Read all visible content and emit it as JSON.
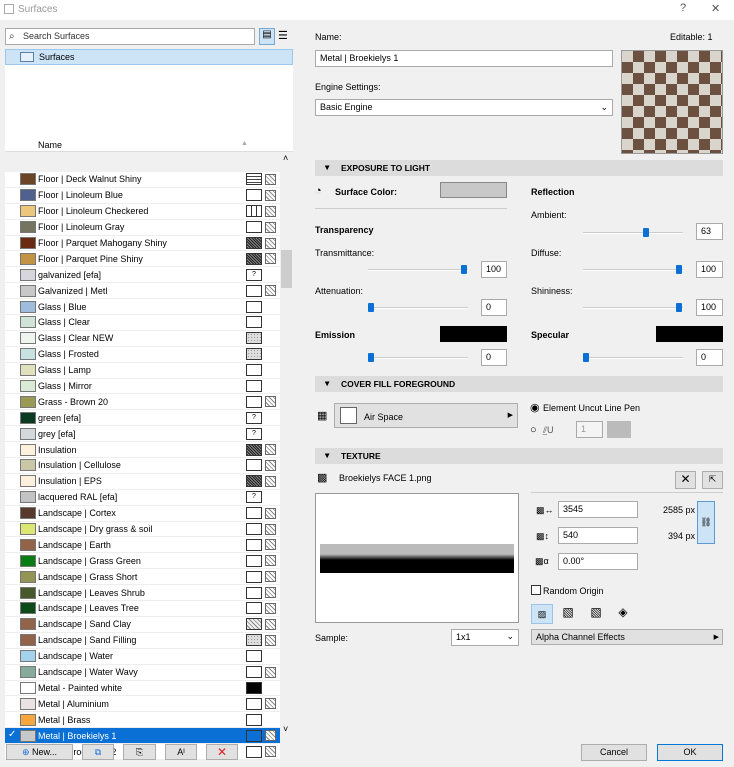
{
  "window": {
    "title": "Surfaces",
    "help": "?",
    "close": "✕"
  },
  "search": {
    "placeholder": "Search Surfaces"
  },
  "tree": {
    "root": "Surfaces"
  },
  "list": {
    "header": "Name",
    "selected_index": 35,
    "items": [
      {
        "name": "Floor | Deck Walnut Shiny",
        "color": "#6b4526",
        "fill": "lines",
        "tex": true
      },
      {
        "name": "Floor | Linoleum Blue",
        "color": "#50608f",
        "fill": "empty",
        "tex": true
      },
      {
        "name": "Floor | Linoleum Checkered",
        "color": "#ecc67c",
        "fill": "grid",
        "tex": true
      },
      {
        "name": "Floor | Linoleum Gray",
        "color": "#747461",
        "fill": "empty",
        "tex": true
      },
      {
        "name": "Floor | Parquet Mahogany Shiny",
        "color": "#6a2a12",
        "fill": "dark",
        "tex": true
      },
      {
        "name": "Floor | Parquet Pine Shiny",
        "color": "#c19342",
        "fill": "dark",
        "tex": true
      },
      {
        "name": "galvanized [efa]",
        "color": "#d6d6dc",
        "fill": "?",
        "tex": false
      },
      {
        "name": "Galvanized | Metl",
        "color": "#c8c8c8",
        "fill": "empty",
        "tex": true
      },
      {
        "name": "Glass | Blue",
        "color": "#a0bcdd",
        "fill": "empty",
        "tex": false
      },
      {
        "name": "Glass | Clear",
        "color": "#cfe4d6",
        "fill": "empty",
        "tex": false
      },
      {
        "name": "Glass | Clear NEW",
        "color": "#eef5ef",
        "fill": "dots",
        "tex": false
      },
      {
        "name": "Glass | Frosted",
        "color": "#c7e2e1",
        "fill": "dots",
        "tex": false
      },
      {
        "name": "Glass | Lamp",
        "color": "#e0e2bd",
        "fill": "empty",
        "tex": false
      },
      {
        "name": "Glass | Mirror",
        "color": "#d9ead5",
        "fill": "empty",
        "tex": false
      },
      {
        "name": "Grass - Brown 20",
        "color": "#9a9a55",
        "fill": "empty",
        "tex": true
      },
      {
        "name": "green [efa]",
        "color": "#0a3a1f",
        "fill": "?",
        "tex": false
      },
      {
        "name": "grey [efa]",
        "color": "#d3d8dc",
        "fill": "?",
        "tex": false
      },
      {
        "name": "Insulation",
        "color": "#fdf0dd",
        "fill": "dark",
        "tex": true
      },
      {
        "name": "Insulation | Cellulose",
        "color": "#c9c7a5",
        "fill": "empty",
        "tex": true
      },
      {
        "name": "Insulation | EPS",
        "color": "#fdf0dd",
        "fill": "dark",
        "tex": true
      },
      {
        "name": "lacquered RAL [efa]",
        "color": "#c2c3c4",
        "fill": "?",
        "tex": false
      },
      {
        "name": "Landscape | Cortex",
        "color": "#573a2b",
        "fill": "empty",
        "tex": true
      },
      {
        "name": "Landscape | Dry grass & soil",
        "color": "#dbe772",
        "fill": "empty",
        "tex": true
      },
      {
        "name": "Landscape | Earth",
        "color": "#916349",
        "fill": "empty",
        "tex": true
      },
      {
        "name": "Landscape | Grass Green",
        "color": "#0a7c14",
        "fill": "empty",
        "tex": true
      },
      {
        "name": "Landscape | Grass Short",
        "color": "#949455",
        "fill": "empty",
        "tex": true
      },
      {
        "name": "Landscape | Leaves Shrub",
        "color": "#47592c",
        "fill": "empty",
        "tex": true
      },
      {
        "name": "Landscape | Leaves Tree",
        "color": "#0c4a19",
        "fill": "empty",
        "tex": true
      },
      {
        "name": "Landscape | Sand Clay",
        "color": "#916349",
        "fill": "hatch",
        "tex": true
      },
      {
        "name": "Landscape | Sand Filling",
        "color": "#916349",
        "fill": "dots",
        "tex": true
      },
      {
        "name": "Landscape | Water",
        "color": "#a4d2ec",
        "fill": "empty",
        "tex": false
      },
      {
        "name": "Landscape | Water Wavy",
        "color": "#87ab9b",
        "fill": "empty",
        "tex": true
      },
      {
        "name": "Metal - Painted white",
        "color": "#ffffff",
        "fill": "black",
        "tex": false
      },
      {
        "name": "Metal | Aluminium",
        "color": "#ebe2e2",
        "fill": "empty",
        "tex": true
      },
      {
        "name": "Metal | Brass",
        "color": "#f8a73d",
        "fill": "empty",
        "tex": false
      },
      {
        "name": "Metal | Broekielys 1",
        "color": "#c8c8c8",
        "fill": "sel",
        "tex": true
      },
      {
        "name": "Metal | Broekielys 2",
        "color": "#c8c8c8",
        "fill": "empty",
        "tex": true
      }
    ]
  },
  "bottom_buttons": {
    "new": "New..."
  },
  "name_field": {
    "label": "Name:",
    "value": "Metal | Broekielys 1",
    "editable": "Editable: 1"
  },
  "engine": {
    "label": "Engine Settings:",
    "value": "Basic Engine"
  },
  "exposure": {
    "title": "EXPOSURE TO LIGHT",
    "surface_color": "Surface Color:",
    "surface_color_value": "#c8c8c8",
    "transparency": "Transparency",
    "transmittance": "Transmittance:",
    "transmittance_value": "100",
    "attenuation": "Attenuation:",
    "attenuation_value": "0",
    "emission": "Emission",
    "emission_value": "0",
    "reflection": "Reflection",
    "ambient": "Ambient:",
    "ambient_value": "63",
    "diffuse": "Diffuse:",
    "diffuse_value": "100",
    "shininess": "Shininess:",
    "shininess_value": "100",
    "specular": "Specular",
    "specular_value": "0"
  },
  "cover": {
    "title": "COVER FILL FOREGROUND",
    "fill": "Air Space",
    "pen_option": "Element Uncut Line Pen",
    "pen_number": "1"
  },
  "texture": {
    "title": "TEXTURE",
    "file": "Broekielys FACE 1.png",
    "width": "3545",
    "height": "540",
    "angle": "0.00°",
    "px_w": "2585 px",
    "px_h": "394 px",
    "random_origin": "Random Origin",
    "sample_label": "Sample:",
    "sample_value": "1x1",
    "alpha": "Alpha Channel Effects"
  },
  "footer": {
    "cancel": "Cancel",
    "ok": "OK"
  }
}
